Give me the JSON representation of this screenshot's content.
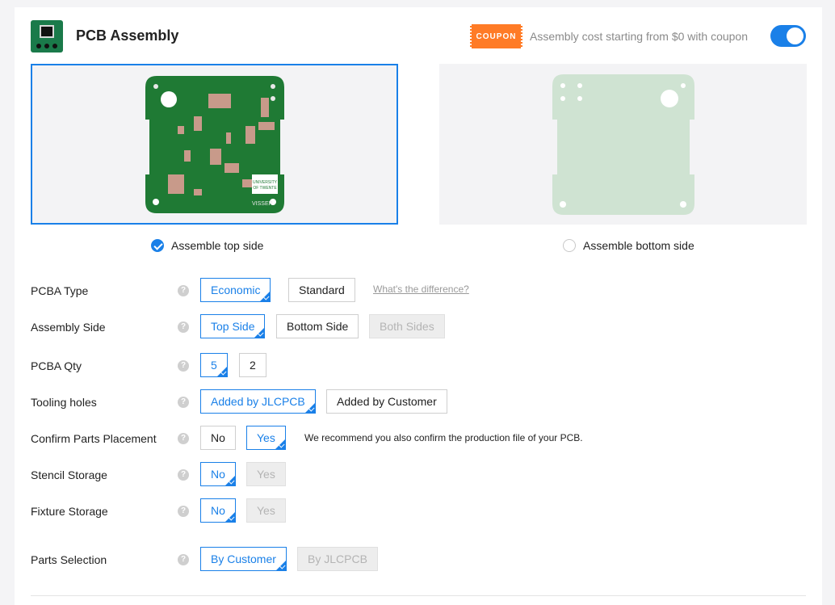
{
  "header": {
    "title": "PCB Assembly",
    "coupon_badge": "COUPON",
    "coupon_text": "Assembly cost starting from $0 with coupon",
    "toggle_on": true
  },
  "sides": {
    "top_label": "Assemble top side",
    "bottom_label": "Assemble bottom side",
    "selected": "top"
  },
  "board_text": {
    "logo_line1": "UNIVERSITY",
    "logo_line2": "OF TWENTE",
    "brand": "VISSER"
  },
  "options": {
    "pcba_type": {
      "label": "PCBA Type",
      "options": [
        "Economic",
        "Standard"
      ],
      "link": "What's the difference?"
    },
    "assembly_side": {
      "label": "Assembly Side",
      "options": [
        "Top Side",
        "Bottom Side",
        "Both Sides"
      ]
    },
    "pcba_qty": {
      "label": "PCBA Qty",
      "options": [
        "5",
        "2"
      ]
    },
    "tooling_holes": {
      "label": "Tooling holes",
      "options": [
        "Added by JLCPCB",
        "Added by Customer"
      ]
    },
    "confirm_parts": {
      "label": "Confirm Parts Placement",
      "options": [
        "No",
        "Yes"
      ],
      "note": "We recommend you also confirm the production file of your PCB."
    },
    "stencil_storage": {
      "label": "Stencil Storage",
      "options": [
        "No",
        "Yes"
      ]
    },
    "fixture_storage": {
      "label": "Fixture Storage",
      "options": [
        "No",
        "Yes"
      ]
    },
    "parts_selection": {
      "label": "Parts Selection",
      "options": [
        "By Customer",
        "By JLCPCB"
      ]
    }
  },
  "help_glyph": "?",
  "colors": {
    "accent": "#1a80e8",
    "coupon": "#ff7b26",
    "board_green": "#1f7a34"
  }
}
